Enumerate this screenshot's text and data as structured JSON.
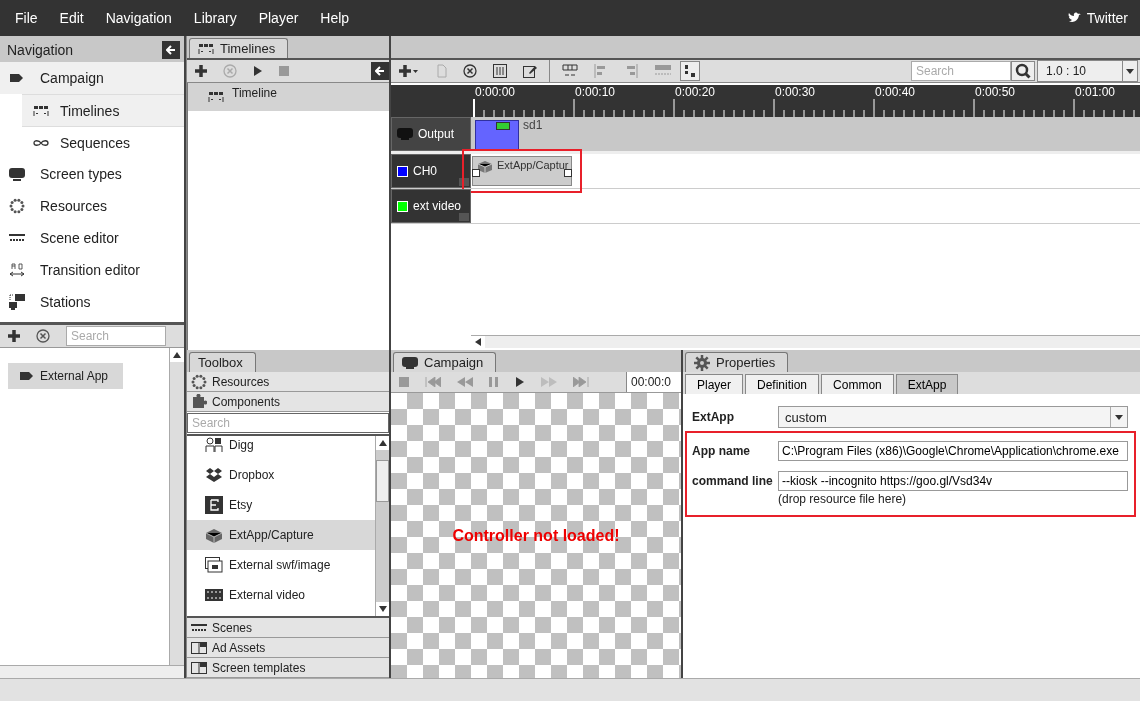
{
  "menu": [
    "File",
    "Edit",
    "Navigation",
    "Library",
    "Player",
    "Help"
  ],
  "twitter": "Twitter",
  "navigation": {
    "title": "Navigation",
    "items": [
      {
        "label": "Campaign",
        "expanded": true,
        "children": [
          {
            "label": "Timelines",
            "selected": true
          },
          {
            "label": "Sequences",
            "selected": false
          }
        ]
      },
      {
        "label": "Screen types",
        "expanded": false
      },
      {
        "label": "Resources",
        "expanded": false
      },
      {
        "label": "Scene editor",
        "expanded": false
      },
      {
        "label": "Transition editor",
        "expanded": false
      },
      {
        "label": "Stations",
        "expanded": false
      }
    ],
    "search": {
      "placeholder": "Search"
    },
    "resources": [
      {
        "label": "External App"
      }
    ]
  },
  "timelines": {
    "tab": "Timelines",
    "items": [
      {
        "label": "Timeline",
        "selected": true
      }
    ]
  },
  "timeline_editor": {
    "search": {
      "placeholder": "Search"
    },
    "zoom": "1.0 : 10",
    "ruler": [
      "0:00:00",
      "0:00:10",
      "0:00:20",
      "0:00:30",
      "0:00:40",
      "0:00:50",
      "0:01:00"
    ],
    "tracks": [
      {
        "kind": "output",
        "name": "Output",
        "clip": {
          "label": "sd1",
          "highlighted": false
        }
      },
      {
        "kind": "channel",
        "name": "CH0",
        "color": "#0000ff",
        "clip": {
          "label": "ExtApp/Captur",
          "highlighted": true
        }
      },
      {
        "kind": "channel",
        "name": "ext video",
        "color": "#00ff00"
      }
    ]
  },
  "toolbox": {
    "tab": "Toolbox",
    "sections_top": [
      "Resources",
      "Components"
    ],
    "search": {
      "placeholder": "Search"
    },
    "components": [
      {
        "label": "Digg",
        "selected": false
      },
      {
        "label": "Dropbox",
        "selected": false
      },
      {
        "label": "Etsy",
        "selected": false
      },
      {
        "label": "ExtApp/Capture",
        "selected": true
      },
      {
        "label": "External swf/image",
        "selected": false
      },
      {
        "label": "External video",
        "selected": false
      }
    ],
    "sections_bottom": [
      "Scenes",
      "Ad Assets",
      "Screen templates"
    ]
  },
  "campaign": {
    "tab": "Campaign",
    "time": "00:00:0",
    "message": "Controller not loaded!"
  },
  "properties": {
    "tab": "Properties",
    "tabs": [
      {
        "label": "Player",
        "selected": false
      },
      {
        "label": "Definition",
        "selected": false
      },
      {
        "label": "Common",
        "selected": false
      },
      {
        "label": "ExtApp",
        "selected": true
      }
    ],
    "extapp_label": "ExtApp",
    "extapp_value": "custom",
    "highlighted": true,
    "app_name_label": "App name",
    "app_name_value": "C:\\Program Files (x86)\\Google\\Chrome\\Application\\chrome.exe",
    "command_label": "command line",
    "command_value": "--kiosk --incognito https://goo.gl/Vsd34v",
    "hint": "(drop resource file here)"
  }
}
